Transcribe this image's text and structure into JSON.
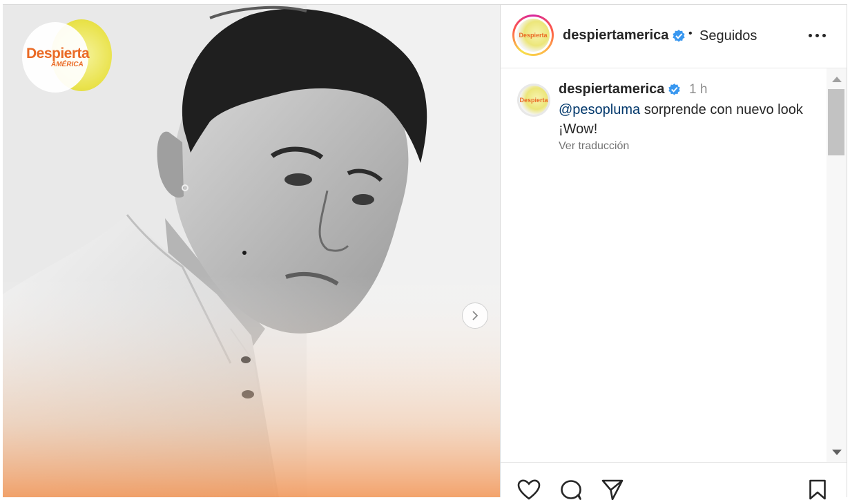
{
  "media": {
    "logo_text_main": "Despierta",
    "logo_text_sub": "AMÉRICA",
    "next_icon": "chevron-right-icon"
  },
  "header": {
    "avatar_text": "Despierta",
    "username": "despiertamerica",
    "verified_icon": "verified-badge-icon",
    "separator": "•",
    "follow_status": "Seguidos",
    "more_icon": "more-options-icon"
  },
  "caption": {
    "avatar_text": "Despierta",
    "username": "despiertamerica",
    "time": "1 h",
    "mention": "@pesopluma",
    "text": " sorprende con nuevo look ¡Wow!",
    "translate": "Ver traducción"
  },
  "actions": {
    "like_icon": "heart-icon",
    "comment_icon": "comment-icon",
    "share_icon": "send-icon",
    "save_icon": "bookmark-icon"
  },
  "colors": {
    "accent_orange": "#ea6a25",
    "verified_blue": "#3897f0",
    "mention_blue": "#00376b",
    "muted_gray": "#8e8e8e"
  }
}
